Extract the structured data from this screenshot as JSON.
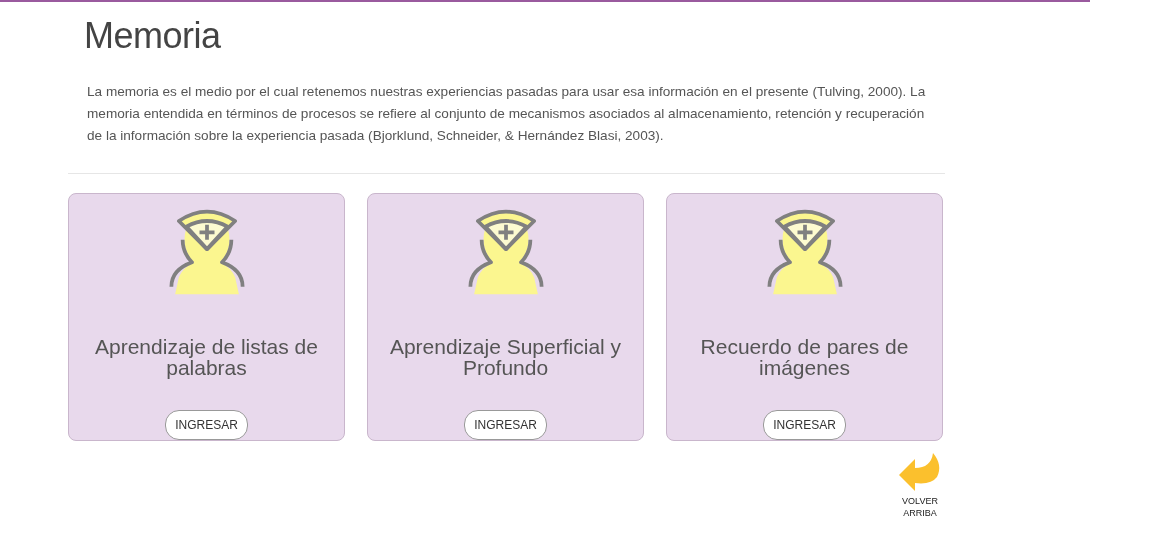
{
  "title": "Memoria",
  "intro": "La memoria es el medio por el cual retenemos nuestras experiencias pasadas para usar esa información en el presente (Tulving, 2000). La memoria entendida en términos de procesos se refiere al conjunto de mecanismos asociados al almacenamiento, retención y recuperación de la información sobre la experiencia pasada (Bjorklund, Schneider, & Hernández Blasi, 2003).",
  "cards": [
    {
      "title": "Aprendizaje de listas de palabras",
      "button": "INGRESAR"
    },
    {
      "title": "Aprendizaje Superficial y Profundo",
      "button": "INGRESAR"
    },
    {
      "title": "Recuerdo de pares de imágenes",
      "button": "INGRESAR"
    }
  ],
  "back_to_top": {
    "label": "VOLVER ARRIBA"
  }
}
